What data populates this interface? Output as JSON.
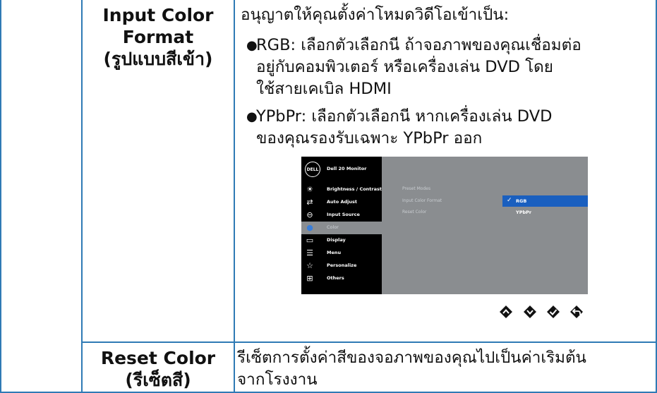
{
  "rows": [
    {
      "label": [
        "Input Color",
        "Format",
        "(รูปแบบสีเข้า)"
      ],
      "intro": "อนุญาตให้คุณตั้งค่าโหมดวิดีโอเข้าเป็น:",
      "bullets": [
        [
          "RGB: เลือกตัวเลือกนี ถ้าจอภาพของคุณเชื่อมต่อ",
          "อยู่กับคอมพิวเตอร์ หรือเครื่องเล่น DVD โดย",
          "ใช้สายเคเบิล HDMI"
        ],
        [
          "YPbPr: เลือกตัวเลือกนี หากเครื่องเล่น DVD",
          "ของคุณรองรับเฉพาะ YPbPr ออก"
        ]
      ]
    },
    {
      "label": [
        "Reset Color",
        "(รีเซ็ตสี)"
      ],
      "desc": [
        "รีเซ็ตการตั้งค่าสีของจอภาพของคุณไปเป็นค่าเริมต้น",
        "จากโรงงาน"
      ]
    }
  ],
  "osd": {
    "logo": "DELL",
    "title": "Dell 20 Monitor",
    "menu": [
      {
        "label": "Brightness / Contrast",
        "icon": "brightness-icon"
      },
      {
        "label": "Auto Adjust",
        "icon": "auto-adjust-icon"
      },
      {
        "label": "Input Source",
        "icon": "input-source-icon"
      },
      {
        "label": "Color",
        "icon": "color-icon"
      },
      {
        "label": "Display",
        "icon": "display-icon"
      },
      {
        "label": "Menu",
        "icon": "menu-icon"
      },
      {
        "label": "Personalize",
        "icon": "star-icon"
      },
      {
        "label": "Others",
        "icon": "others-icon"
      }
    ],
    "submenu": [
      "Preset Modes",
      "Input Color Format",
      "Reset Color"
    ],
    "options": [
      "RGB",
      "YPbPr"
    ]
  }
}
